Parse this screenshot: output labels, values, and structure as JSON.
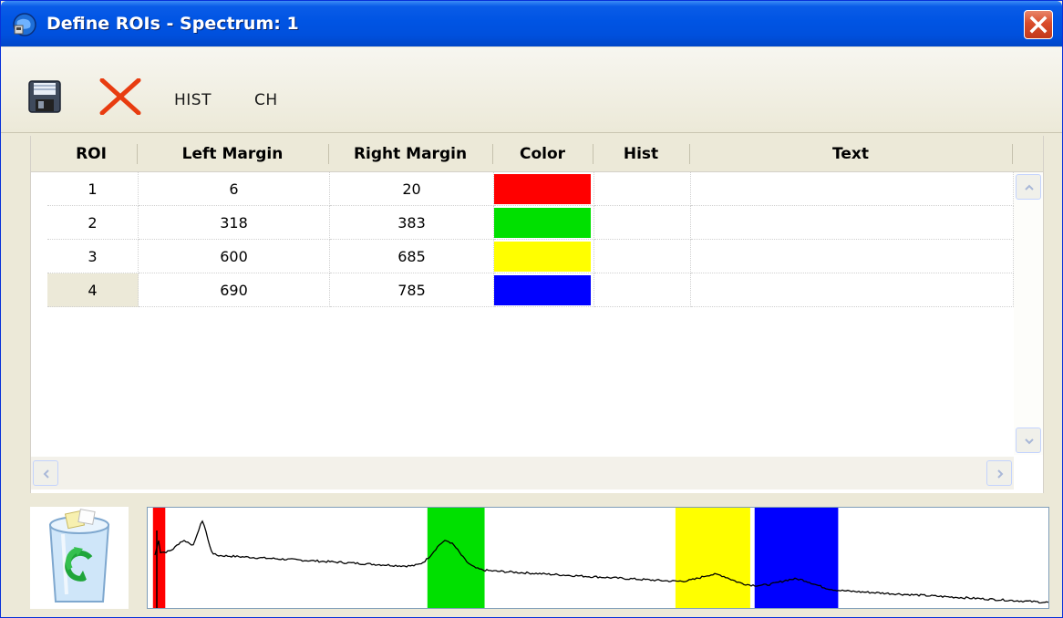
{
  "window": {
    "title": "Define ROIs - Spectrum: 1"
  },
  "toolbar": {
    "save_icon": "floppy-disk-icon",
    "delete_icon": "red-x-icon",
    "hist_label": "HIST",
    "ch_label": "CH"
  },
  "grid": {
    "columns": [
      "ROI",
      "Left Margin",
      "Right Margin",
      "Color",
      "Hist",
      "Text"
    ],
    "rows": [
      {
        "roi": "1",
        "left": "6",
        "right": "20",
        "color": "#ff0000",
        "hist": "",
        "text": ""
      },
      {
        "roi": "2",
        "left": "318",
        "right": "383",
        "color": "#00e000",
        "hist": "",
        "text": ""
      },
      {
        "roi": "3",
        "left": "600",
        "right": "685",
        "color": "#ffff00",
        "hist": "",
        "text": ""
      },
      {
        "roi": "4",
        "left": "690",
        "right": "785",
        "color": "#0000ff",
        "hist": "",
        "text": ""
      }
    ],
    "selected_row": 4
  },
  "spectrum": {
    "channel_range": [
      0,
      1024
    ],
    "rois": [
      {
        "from": 6,
        "to": 20,
        "color": "#ff0000"
      },
      {
        "from": 318,
        "to": 383,
        "color": "#00e000"
      },
      {
        "from": 600,
        "to": 685,
        "color": "#ffff00"
      },
      {
        "from": 690,
        "to": 785,
        "color": "#0000ff"
      }
    ]
  },
  "colors": {
    "titlebar": "#0054e3",
    "window_bg": "#ece9d8",
    "close_button": "#d94b2a"
  }
}
